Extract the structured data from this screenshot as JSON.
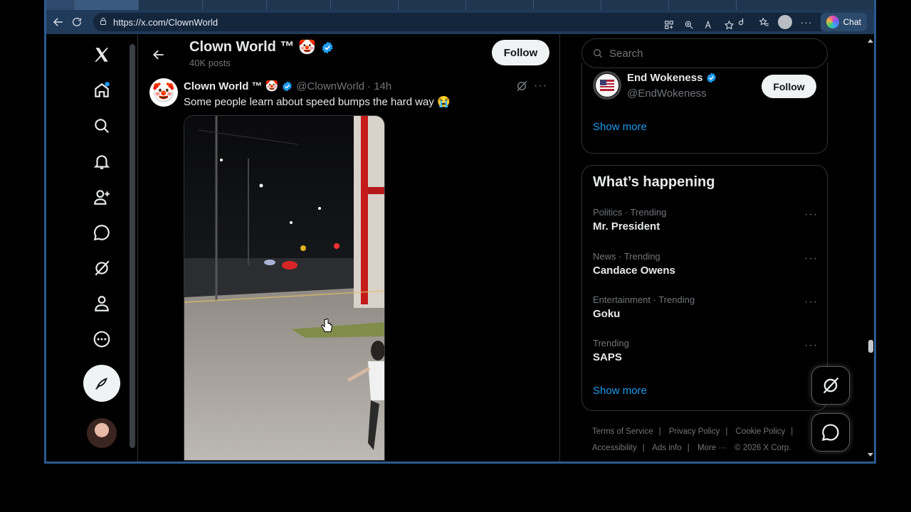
{
  "browser": {
    "url": "https://x.com/ClownWorld",
    "chat_label": "Chat"
  },
  "header": {
    "title": "Clown World ™",
    "posts_count": "40K posts",
    "follow_label": "Follow"
  },
  "post": {
    "name": "Clown World ™",
    "handle": "@ClownWorld",
    "time": "· 14h",
    "text": "Some people learn about speed bumps the hard way",
    "emoji": "😭",
    "avatar_emoji": "🤡"
  },
  "sidebar_right": {
    "search_placeholder": "Search",
    "who_to_follow": {
      "name": "End Wokeness",
      "handle": "@EndWokeness",
      "follow_label": "Follow",
      "show_more": "Show more"
    },
    "trending": {
      "title": "What’s happening",
      "items": [
        {
          "context": "Politics · Trending",
          "topic": "Mr. President"
        },
        {
          "context": "News · Trending",
          "topic": "Candace Owens"
        },
        {
          "context": "Entertainment · Trending",
          "topic": "Goku"
        },
        {
          "context": "Trending",
          "topic": "SAPS"
        }
      ],
      "show_more": "Show more"
    },
    "footer": {
      "links": [
        "Terms of Service",
        "Privacy Policy",
        "Cookie Policy",
        "Accessibility",
        "Ads info",
        "More ···"
      ],
      "copyright": "© 2026 X Corp."
    }
  },
  "colors": {
    "accent": "#1d9bf0",
    "background": "#000000",
    "border": "#2f3336",
    "muted": "#71767b"
  }
}
